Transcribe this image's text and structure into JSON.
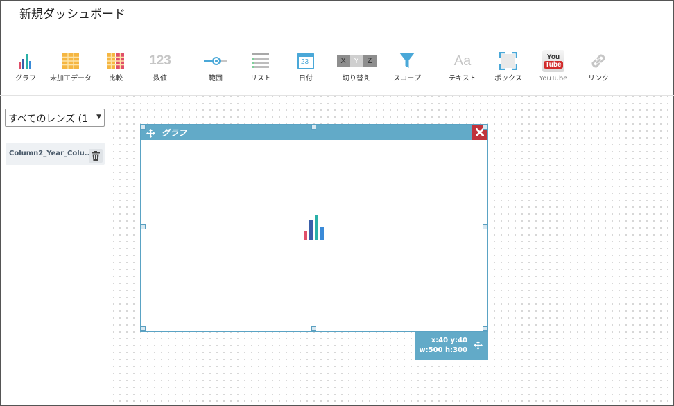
{
  "page": {
    "title": "新規ダッシュボード"
  },
  "toolbar": {
    "items": [
      {
        "label": "グラフ",
        "icon": "chart-icon"
      },
      {
        "label": "未加工データ",
        "icon": "raw-data-icon"
      },
      {
        "label": "比較",
        "icon": "compare-icon"
      },
      {
        "label": "数値",
        "icon": "number-icon",
        "icon_text": "123"
      },
      {
        "label": "範囲",
        "icon": "range-icon"
      },
      {
        "label": "リスト",
        "icon": "list-icon"
      },
      {
        "label": "日付",
        "icon": "date-icon",
        "icon_text": "23"
      },
      {
        "label": "切り替え",
        "icon": "toggle-icon",
        "icon_text": [
          "X",
          "Y",
          "Z"
        ]
      },
      {
        "label": "スコープ",
        "icon": "scope-icon"
      },
      {
        "label": "テキスト",
        "icon": "text-icon",
        "icon_text": "Aa"
      },
      {
        "label": "ボックス",
        "icon": "box-icon"
      },
      {
        "label": "YouTube",
        "icon": "youtube-icon",
        "icon_text": [
          "You",
          "Tube"
        ]
      },
      {
        "label": "リンク",
        "icon": "link-icon"
      }
    ]
  },
  "sidebar": {
    "lens_select": "すべてのレンズ (1",
    "fields": [
      {
        "label": "Column2_Year_Colu..."
      }
    ]
  },
  "widget": {
    "title": "グラフ",
    "geometry_line1": "x:40 y:40",
    "geometry_line2": "w:500 h:300"
  },
  "colors": {
    "accent": "#62aac8",
    "close": "#c0343c",
    "chart_bars": [
      "#e0506a",
      "#3a5faa",
      "#2ab0a8",
      "#3a8ad8"
    ]
  }
}
